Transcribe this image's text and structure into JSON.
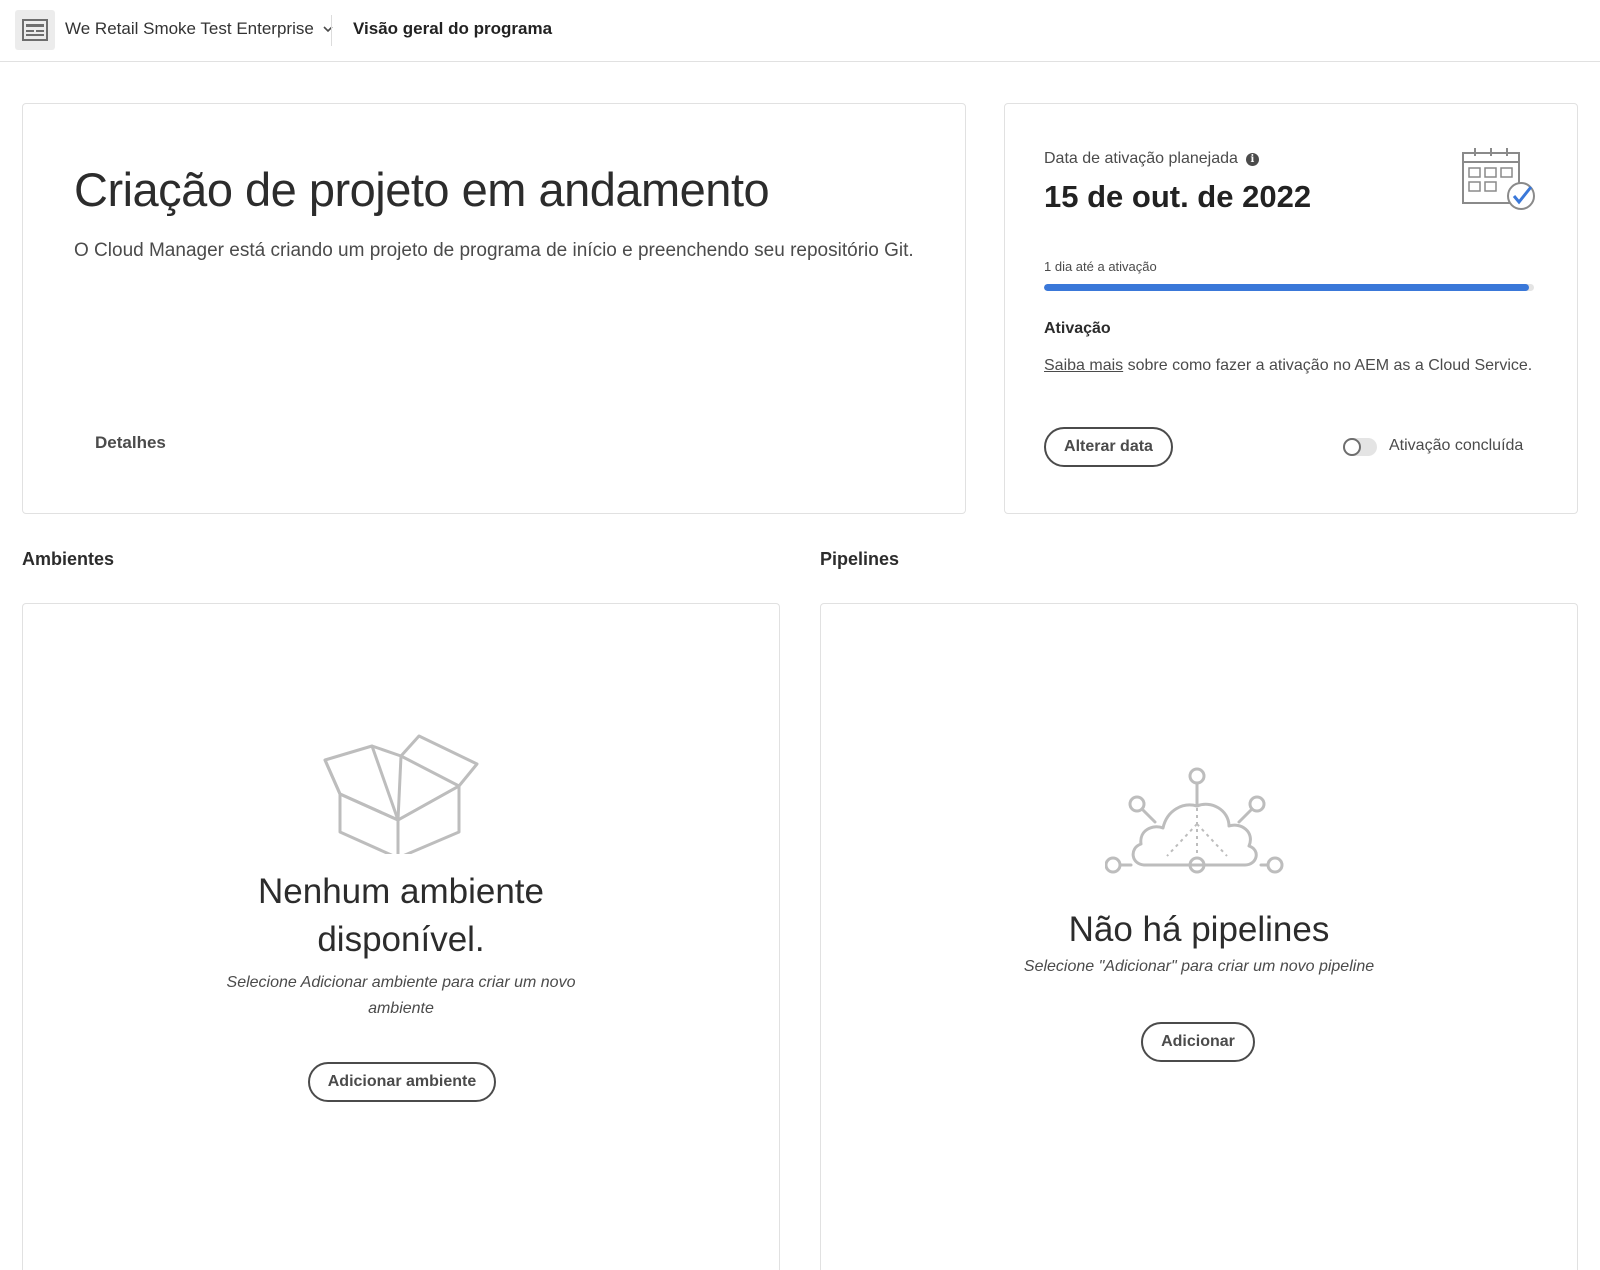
{
  "header": {
    "program_name": "We Retail Smoke Test Enterprise",
    "page_title": "Visão geral do programa"
  },
  "hero": {
    "title": "Criação de projeto em andamento",
    "description": "O Cloud Manager está criando um projeto de programa de início e preenchendo seu repositório Git.",
    "details_link": "Detalhes"
  },
  "golive": {
    "label": "Data de ativação planejada",
    "date": "15 de out. de 2022",
    "days_text": "1 dia até a ativação",
    "progress_fraction": 0.99,
    "section_title": "Ativação",
    "learn_more_link": "Saiba mais",
    "learn_more_rest": " sobre como fazer a ativação no AEM as a Cloud Service.",
    "change_date_button": "Alterar data",
    "toggle_label": "Ativação concluída",
    "toggle_on": false,
    "accent_color": "#3a78d9"
  },
  "environments": {
    "section_title": "Ambientes",
    "empty_title_line1": "Nenhum ambiente",
    "empty_title_line2": "disponível.",
    "empty_sub_line1": "Selecione Adicionar ambiente para criar um novo",
    "empty_sub_line2": "ambiente",
    "add_button": "Adicionar ambiente"
  },
  "pipelines": {
    "section_title": "Pipelines",
    "empty_title": "Não há pipelines",
    "empty_sub": "Selecione \"Adicionar\" para criar um novo pipeline",
    "add_button": "Adicionar"
  },
  "icons": {
    "program": "program-icon",
    "dropdown": "chevron-down-icon",
    "info": "info-icon",
    "calendar": "calendar-check-icon",
    "box": "empty-box-icon",
    "cloud": "cloud-network-icon"
  }
}
